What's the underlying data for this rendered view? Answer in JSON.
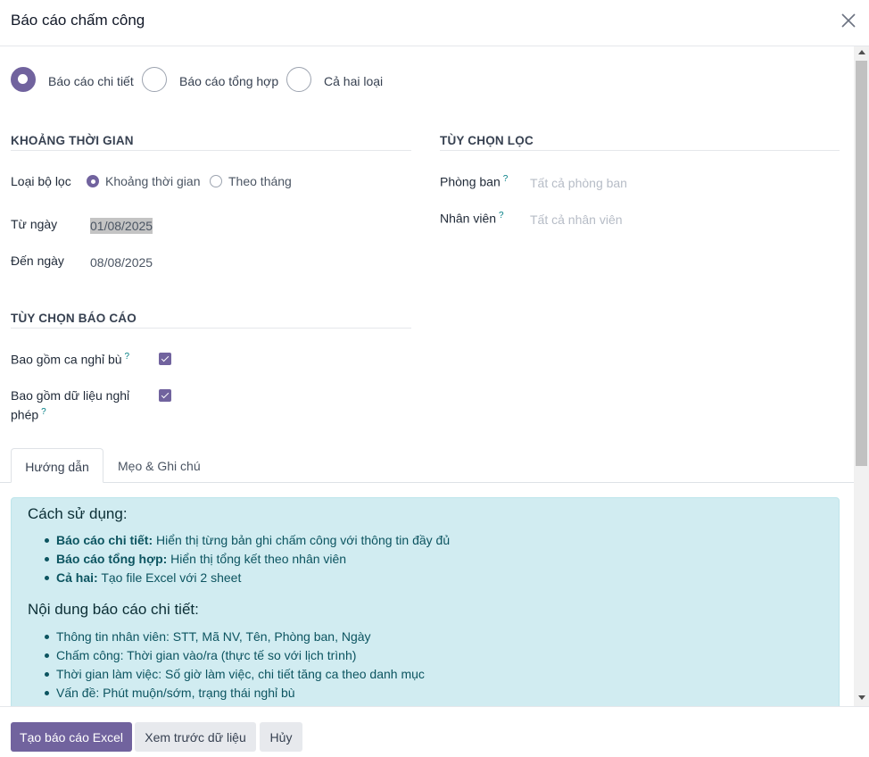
{
  "dialog": {
    "title": "Báo cáo chấm công"
  },
  "report_type": {
    "options": [
      {
        "label": "Báo cáo chi tiết",
        "checked": true
      },
      {
        "label": "Báo cáo tổng hợp",
        "checked": false
      },
      {
        "label": "Cả hai loại",
        "checked": false
      }
    ]
  },
  "time_range": {
    "section_title": "KHOẢNG THỜI GIAN",
    "filter_type_label": "Loại bộ lọc",
    "filter_options": [
      {
        "label": "Khoảng thời gian",
        "checked": true
      },
      {
        "label": "Theo tháng",
        "checked": false
      }
    ],
    "from_label": "Từ ngày",
    "from_value": "01/08/2025",
    "to_label": "Đến ngày",
    "to_value": "08/08/2025"
  },
  "filter_options": {
    "section_title": "TÙY CHỌN LỌC",
    "department_label": "Phòng ban",
    "department_placeholder": "Tất cả phòng ban",
    "employee_label": "Nhân viên",
    "employee_placeholder": "Tất cả nhân viên",
    "help_mark": "?"
  },
  "report_options": {
    "section_title": "TÙY CHỌN BÁO CÁO",
    "include_comp_shift_label": "Bao gồm ca nghỉ bù",
    "include_comp_shift": true,
    "include_leave_label_line1": "Bao gồm dữ liệu nghỉ",
    "include_leave_label_line2": "phép",
    "include_leave": true
  },
  "tabs": [
    {
      "label": "Hướng dẫn",
      "active": true
    },
    {
      "label": "Mẹo & Ghi chú",
      "active": false
    }
  ],
  "guide": {
    "usage_title": "Cách sử dụng:",
    "usage_items": [
      {
        "bold": "Báo cáo chi tiết:",
        "text": " Hiển thị từng bản ghi chấm công với thông tin đầy đủ"
      },
      {
        "bold": "Báo cáo tổng hợp:",
        "text": " Hiển thị tổng kết theo nhân viên"
      },
      {
        "bold": "Cả hai:",
        "text": " Tạo file Excel với 2 sheet"
      }
    ],
    "detail_title": "Nội dung báo cáo chi tiết:",
    "detail_items": [
      "Thông tin nhân viên: STT, Mã NV, Tên, Phòng ban, Ngày",
      "Chấm công: Thời gian vào/ra (thực tế so với lịch trình)",
      "Thời gian làm việc: Số giờ làm việc, chi tiết tăng ca theo danh mục",
      "Vấn đề: Phút muộn/sớm, trạng thái nghỉ bù"
    ]
  },
  "footer": {
    "generate_label": "Tạo báo cáo Excel",
    "preview_label": "Xem trước dữ liệu",
    "cancel_label": "Hủy"
  },
  "colors": {
    "accent": "#71639e",
    "info_bg": "#d1ecf1",
    "info_text": "#0c5460"
  }
}
